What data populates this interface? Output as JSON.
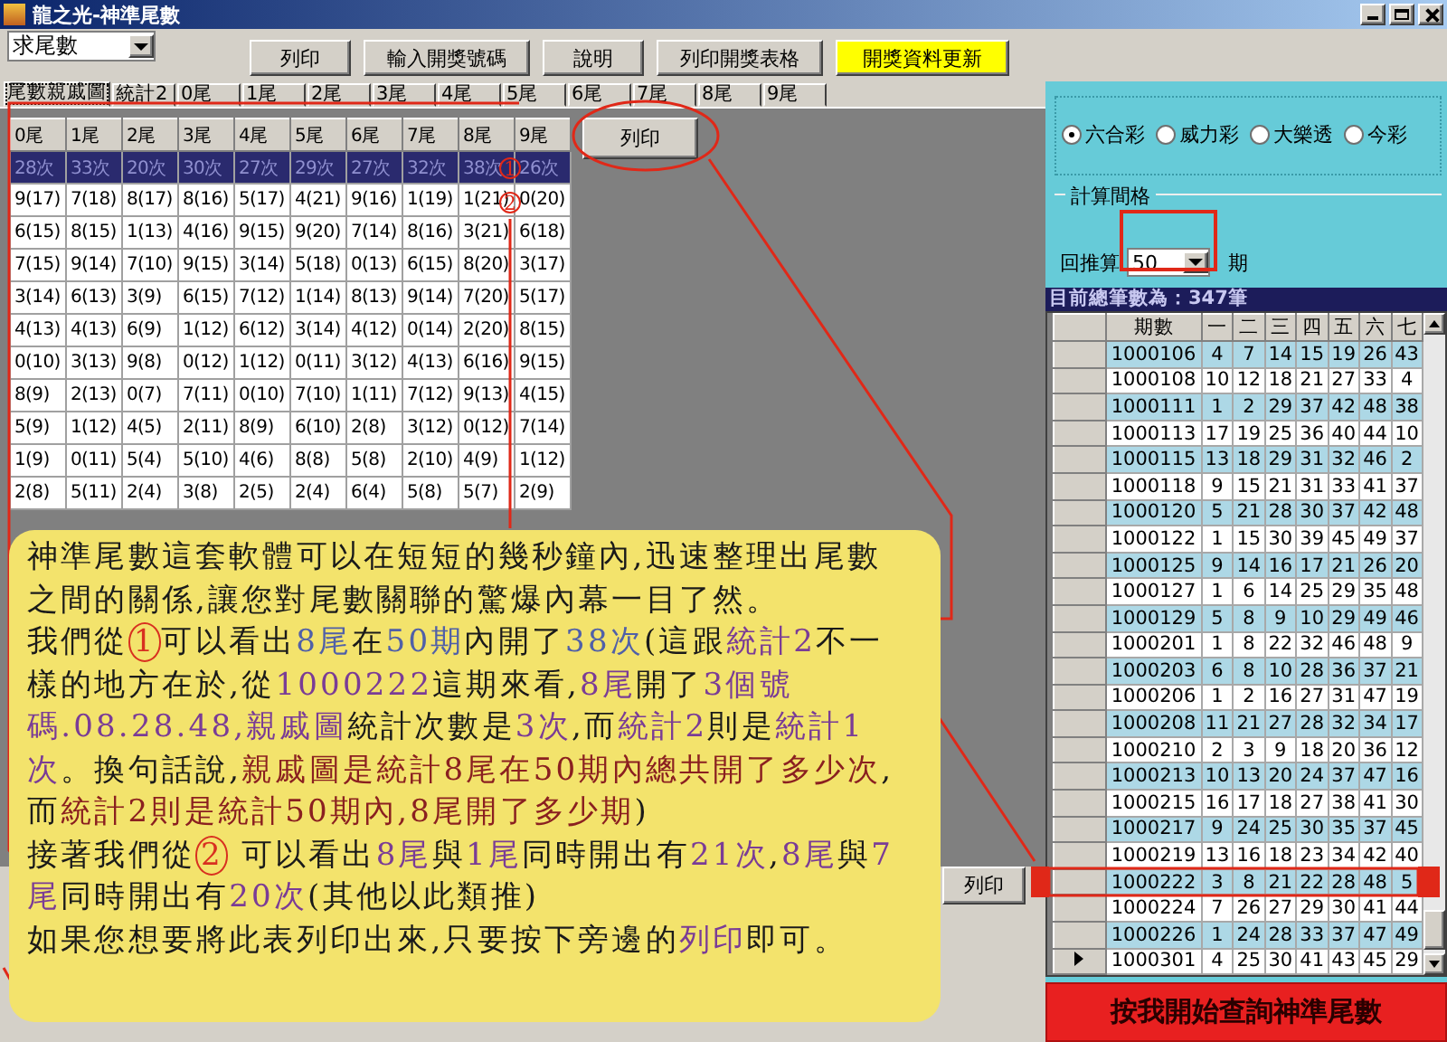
{
  "window": {
    "title": "龍之光-神準尾數"
  },
  "toolbar": {
    "mode_select": {
      "value": "求尾數"
    },
    "buttons": [
      {
        "label": "列印",
        "kind": "normal"
      },
      {
        "label": "輸入開獎號碼",
        "kind": "normal"
      },
      {
        "label": "說明",
        "kind": "normal"
      },
      {
        "label": "列印開獎表格",
        "kind": "normal"
      },
      {
        "label": "開獎資料更新",
        "kind": "highlight"
      }
    ]
  },
  "tabs": [
    {
      "label": "尾數親戚圖",
      "selected": true
    },
    {
      "label": "統計2",
      "selected": false
    },
    {
      "label": "0尾",
      "selected": false
    },
    {
      "label": "1尾",
      "selected": false
    },
    {
      "label": "2尾",
      "selected": false
    },
    {
      "label": "3尾",
      "selected": false
    },
    {
      "label": "4尾",
      "selected": false
    },
    {
      "label": "5尾",
      "selected": false
    },
    {
      "label": "6尾",
      "selected": false
    },
    {
      "label": "7尾",
      "selected": false
    },
    {
      "label": "8尾",
      "selected": false
    },
    {
      "label": "9尾",
      "selected": false
    }
  ],
  "tail_grid": {
    "columns": [
      "0尾",
      "1尾",
      "2尾",
      "3尾",
      "4尾",
      "5尾",
      "6尾",
      "7尾",
      "8尾",
      "9尾"
    ],
    "rows": [
      {
        "selected": true,
        "cells": [
          "28次",
          "33次",
          "20次",
          "30次",
          "27次",
          "29次",
          "27次",
          "32次",
          "38次",
          "26次"
        ]
      },
      {
        "selected": false,
        "cells": [
          "9(17)",
          "7(18)",
          "8(17)",
          "8(16)",
          "5(17)",
          "4(21)",
          "9(16)",
          "1(19)",
          "1(21)",
          "0(20)"
        ]
      },
      {
        "selected": false,
        "cells": [
          "6(15)",
          "8(15)",
          "1(13)",
          "4(16)",
          "9(15)",
          "9(20)",
          "7(14)",
          "8(16)",
          "3(21)",
          "6(18)"
        ]
      },
      {
        "selected": false,
        "cells": [
          "7(15)",
          "9(14)",
          "7(10)",
          "9(15)",
          "3(14)",
          "5(18)",
          "0(13)",
          "6(15)",
          "8(20)",
          "3(17)"
        ]
      },
      {
        "selected": false,
        "cells": [
          "3(14)",
          "6(13)",
          "3(9)",
          "6(15)",
          "7(12)",
          "1(14)",
          "8(13)",
          "9(14)",
          "7(20)",
          "5(17)"
        ]
      },
      {
        "selected": false,
        "cells": [
          "4(13)",
          "4(13)",
          "6(9)",
          "1(12)",
          "6(12)",
          "3(14)",
          "4(12)",
          "0(14)",
          "2(20)",
          "8(15)"
        ]
      },
      {
        "selected": false,
        "cells": [
          "0(10)",
          "3(13)",
          "9(8)",
          "0(12)",
          "1(12)",
          "0(11)",
          "3(12)",
          "4(13)",
          "6(16)",
          "9(15)"
        ]
      },
      {
        "selected": false,
        "cells": [
          "8(9)",
          "2(13)",
          "0(7)",
          "7(11)",
          "0(10)",
          "7(10)",
          "1(11)",
          "7(12)",
          "9(13)",
          "4(15)"
        ]
      },
      {
        "selected": false,
        "cells": [
          "5(9)",
          "1(12)",
          "4(5)",
          "2(11)",
          "8(9)",
          "6(10)",
          "2(8)",
          "3(12)",
          "0(12)",
          "7(14)"
        ]
      },
      {
        "selected": false,
        "cells": [
          "1(9)",
          "0(11)",
          "5(4)",
          "5(10)",
          "4(6)",
          "8(8)",
          "5(8)",
          "2(10)",
          "4(9)",
          "1(12)"
        ]
      },
      {
        "selected": false,
        "cells": [
          "2(8)",
          "5(11)",
          "2(4)",
          "3(8)",
          "2(5)",
          "2(4)",
          "6(4)",
          "5(8)",
          "5(7)",
          "2(9)"
        ]
      }
    ]
  },
  "print_button": {
    "label": "列印"
  },
  "bottom_print_button": {
    "label": "列印"
  },
  "lottery_types": [
    {
      "label": "六合彩",
      "selected": true
    },
    {
      "label": "威力彩",
      "selected": false
    },
    {
      "label": "大樂透",
      "selected": false
    },
    {
      "label": "今彩",
      "selected": false
    }
  ],
  "interval_group": {
    "title": "計算間格",
    "label": "回推算",
    "value": "50",
    "unit": "期"
  },
  "draws": {
    "caption": "目前總筆數為：347筆",
    "columns": [
      "期數",
      "一",
      "二",
      "三",
      "四",
      "五",
      "六",
      "七"
    ],
    "rows": [
      {
        "period": "1000106",
        "balls": [
          "4",
          "7",
          "14",
          "15",
          "19",
          "26",
          "43"
        ],
        "current": false
      },
      {
        "period": "1000108",
        "balls": [
          "10",
          "12",
          "18",
          "21",
          "27",
          "33",
          "4"
        ],
        "current": false
      },
      {
        "period": "1000111",
        "balls": [
          "1",
          "2",
          "29",
          "37",
          "42",
          "48",
          "38"
        ],
        "current": false
      },
      {
        "period": "1000113",
        "balls": [
          "17",
          "19",
          "25",
          "36",
          "40",
          "44",
          "10"
        ],
        "current": false
      },
      {
        "period": "1000115",
        "balls": [
          "13",
          "18",
          "29",
          "31",
          "32",
          "46",
          "2"
        ],
        "current": false
      },
      {
        "period": "1000118",
        "balls": [
          "9",
          "15",
          "21",
          "31",
          "33",
          "41",
          "37"
        ],
        "current": false
      },
      {
        "period": "1000120",
        "balls": [
          "5",
          "21",
          "28",
          "30",
          "37",
          "42",
          "48"
        ],
        "current": false
      },
      {
        "period": "1000122",
        "balls": [
          "1",
          "15",
          "30",
          "39",
          "45",
          "49",
          "37"
        ],
        "current": false
      },
      {
        "period": "1000125",
        "balls": [
          "9",
          "14",
          "16",
          "17",
          "21",
          "26",
          "20"
        ],
        "current": false
      },
      {
        "period": "1000127",
        "balls": [
          "1",
          "6",
          "14",
          "25",
          "29",
          "35",
          "48"
        ],
        "current": false
      },
      {
        "period": "1000129",
        "balls": [
          "5",
          "8",
          "9",
          "10",
          "29",
          "49",
          "46"
        ],
        "current": false
      },
      {
        "period": "1000201",
        "balls": [
          "1",
          "8",
          "22",
          "32",
          "46",
          "48",
          "9"
        ],
        "current": false
      },
      {
        "period": "1000203",
        "balls": [
          "6",
          "8",
          "10",
          "28",
          "36",
          "37",
          "21"
        ],
        "current": false
      },
      {
        "period": "1000206",
        "balls": [
          "1",
          "2",
          "16",
          "27",
          "31",
          "47",
          "19"
        ],
        "current": false
      },
      {
        "period": "1000208",
        "balls": [
          "11",
          "21",
          "27",
          "28",
          "32",
          "34",
          "17"
        ],
        "current": false
      },
      {
        "period": "1000210",
        "balls": [
          "2",
          "3",
          "9",
          "18",
          "20",
          "36",
          "12"
        ],
        "current": false
      },
      {
        "period": "1000213",
        "balls": [
          "10",
          "13",
          "20",
          "24",
          "37",
          "47",
          "16"
        ],
        "current": false
      },
      {
        "period": "1000215",
        "balls": [
          "16",
          "17",
          "18",
          "27",
          "38",
          "41",
          "30"
        ],
        "current": false
      },
      {
        "period": "1000217",
        "balls": [
          "9",
          "24",
          "25",
          "30",
          "35",
          "37",
          "45"
        ],
        "current": false
      },
      {
        "period": "1000219",
        "balls": [
          "13",
          "16",
          "18",
          "23",
          "34",
          "42",
          "40"
        ],
        "current": false
      },
      {
        "period": "1000222",
        "balls": [
          "3",
          "8",
          "21",
          "22",
          "28",
          "48",
          "5"
        ],
        "current": false
      },
      {
        "period": "1000224",
        "balls": [
          "7",
          "26",
          "27",
          "29",
          "30",
          "41",
          "44"
        ],
        "current": false
      },
      {
        "period": "1000226",
        "balls": [
          "1",
          "24",
          "28",
          "33",
          "37",
          "47",
          "49"
        ],
        "current": false
      },
      {
        "period": "1000301",
        "balls": [
          "4",
          "25",
          "30",
          "41",
          "43",
          "45",
          "29"
        ],
        "current": true
      }
    ]
  },
  "query_button": {
    "label": "按我開始查詢神準尾數"
  },
  "annotations": {
    "marks": [
      "1",
      "2"
    ]
  },
  "callout": {
    "paragraphs": [
      [
        {
          "text": "神準尾數這套軟體可以在短短的幾秒鐘內,迅速整理出尾數之間的關係,讓您對尾數關聯的驚爆內幕一目了然。",
          "color": "#1a1a1a",
          "circled": false
        }
      ],
      [
        {
          "text": "我們從",
          "color": "#1a1a1a",
          "circled": false
        },
        {
          "text": "1",
          "color": "#d83020",
          "circled": true
        },
        {
          "text": "可以看出",
          "color": "#1a1a1a",
          "circled": false
        },
        {
          "text": "8尾",
          "color": "#5060a8",
          "circled": false
        },
        {
          "text": "在",
          "color": "#1a1a1a",
          "circled": false
        },
        {
          "text": "50期",
          "color": "#5060a8",
          "circled": false
        },
        {
          "text": "內開了",
          "color": "#1a1a1a",
          "circled": false
        },
        {
          "text": "38次",
          "color": "#5060a8",
          "circled": false
        },
        {
          "text": "(這跟",
          "color": "#1a1a1a",
          "circled": false
        },
        {
          "text": "統計2",
          "color": "#7a3c96",
          "circled": false
        },
        {
          "text": "不一樣的地方在於,從",
          "color": "#1a1a1a",
          "circled": false
        },
        {
          "text": "1000222",
          "color": "#7a3c96",
          "circled": false
        },
        {
          "text": "這期來看,",
          "color": "#1a1a1a",
          "circled": false
        },
        {
          "text": "8尾",
          "color": "#7a3c96",
          "circled": false
        },
        {
          "text": "開了",
          "color": "#1a1a1a",
          "circled": false
        },
        {
          "text": "3個號碼.08.28.48,親戚圖",
          "color": "#7a3c96",
          "circled": false
        },
        {
          "text": "統計次數是",
          "color": "#1a1a1a",
          "circled": false
        },
        {
          "text": "3次",
          "color": "#7a3c96",
          "circled": false
        },
        {
          "text": ",而",
          "color": "#1a1a1a",
          "circled": false
        },
        {
          "text": "統計2",
          "color": "#7a3c96",
          "circled": false
        },
        {
          "text": "則是",
          "color": "#1a1a1a",
          "circled": false
        },
        {
          "text": "統計1次",
          "color": "#7a3c96",
          "circled": false
        },
        {
          "text": "。換句話說,",
          "color": "#1a1a1a",
          "circled": false
        },
        {
          "text": "親戚圖是統計8尾在50期內總共開了多少次",
          "color": "#8a2020",
          "circled": false
        },
        {
          "text": ",而",
          "color": "#1a1a1a",
          "circled": false
        },
        {
          "text": "統計2則是統計50期內,8尾開了多少期",
          "color": "#8a2020",
          "circled": false
        },
        {
          "text": ")",
          "color": "#1a1a1a",
          "circled": false
        }
      ],
      [
        {
          "text": "接著我們從",
          "color": "#1a1a1a",
          "circled": false
        },
        {
          "text": "2",
          "color": "#d83020",
          "circled": true
        },
        {
          "text": " 可以看出",
          "color": "#1a1a1a",
          "circled": false
        },
        {
          "text": "8尾",
          "color": "#7a3c96",
          "circled": false
        },
        {
          "text": "與",
          "color": "#1a1a1a",
          "circled": false
        },
        {
          "text": "1尾",
          "color": "#7a3c96",
          "circled": false
        },
        {
          "text": "同時開出有",
          "color": "#1a1a1a",
          "circled": false
        },
        {
          "text": "21次",
          "color": "#7a3c96",
          "circled": false
        },
        {
          "text": ",",
          "color": "#1a1a1a",
          "circled": false
        },
        {
          "text": "8尾",
          "color": "#7a3c96",
          "circled": false
        },
        {
          "text": "與",
          "color": "#1a1a1a",
          "circled": false
        },
        {
          "text": "7尾",
          "color": "#7a3c96",
          "circled": false
        },
        {
          "text": "同時開出有",
          "color": "#1a1a1a",
          "circled": false
        },
        {
          "text": "20次",
          "color": "#7a3c96",
          "circled": false
        },
        {
          "text": "(其他以此類推)",
          "color": "#1a1a1a",
          "circled": false
        }
      ],
      [
        {
          "text": "如果您想要將此表列印出來,只要按下旁邊的",
          "color": "#1a1a1a",
          "circled": false
        },
        {
          "text": "列印",
          "color": "#7a3c96",
          "circled": false
        },
        {
          "text": "即可。",
          "color": "#1a1a1a",
          "circled": false
        }
      ]
    ]
  }
}
